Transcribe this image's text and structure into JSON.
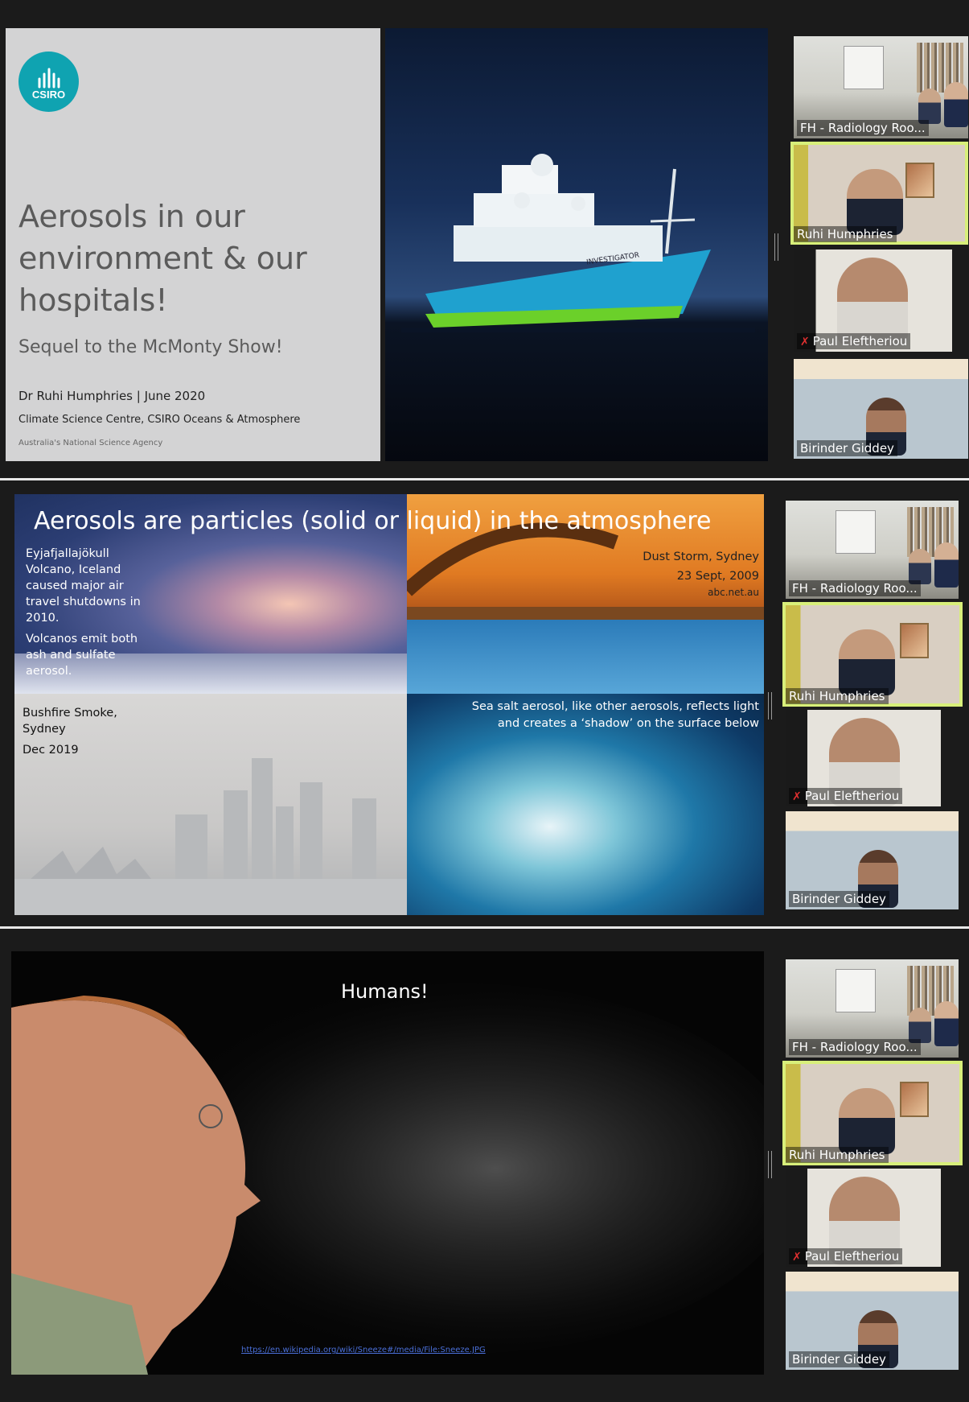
{
  "frame1": {
    "logo_text": "CSIRO",
    "title_line1": "Aerosols in our",
    "title_line2": "environment & our",
    "title_line3": "hospitals!",
    "subtitle": "Sequel to the McMonty Show!",
    "author_line": "Dr Ruhi Humphries  |  June 2020",
    "affiliation": "Climate Science Centre, CSIRO Oceans & Atmosphere",
    "tagline": "Australia's National Science Agency",
    "ship_label": "INVESTIGATOR"
  },
  "frame2": {
    "title": "Aerosols are particles (solid or liquid) in the atmosphere",
    "volcano_text": [
      "Eyjafjallajökull",
      "Volcano, Iceland",
      "caused major air",
      "travel shutdowns in",
      "2010."
    ],
    "volcano_text2": [
      "Volcanos emit both",
      "ash and sulfate",
      "aerosol."
    ],
    "dust_line1": "Dust Storm, Sydney",
    "dust_line2": "23 Sept, 2009",
    "dust_source": "abc.net.au",
    "bushfire_line1": "Bushfire Smoke,",
    "bushfire_line2": "Sydney",
    "bushfire_line3": "Dec 2019",
    "seasalt_line1": "Sea salt aerosol, like other aerosols, reflects light",
    "seasalt_line2": "and creates a ‘shadow’ on the surface below"
  },
  "frame3": {
    "title": "Humans!",
    "link": "https://en.wikipedia.org/wiki/Sneeze#/media/File:Sneeze.JPG"
  },
  "participants": [
    {
      "name": "FH - Radiology Roo..."
    },
    {
      "name": "Ruhi Humphries"
    },
    {
      "name": "Paul Eleftheriou"
    },
    {
      "name": "Birinder Giddey"
    }
  ],
  "icons": {
    "mute": "microphone-muted-icon"
  },
  "colors": {
    "active_speaker": "#d8ef7a",
    "csiro_teal": "#0fa3b1"
  }
}
